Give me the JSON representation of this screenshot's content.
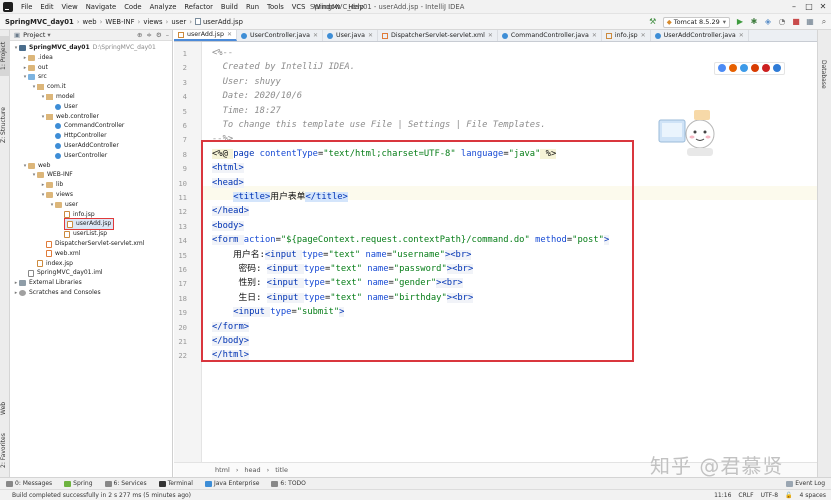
{
  "menubar": {
    "items": [
      "File",
      "Edit",
      "View",
      "Navigate",
      "Code",
      "Analyze",
      "Refactor",
      "Build",
      "Run",
      "Tools",
      "VCS",
      "Window",
      "Help"
    ],
    "window_title": "SpringMVC_day01 - userAdd.jsp - IntelliJ IDEA"
  },
  "navbar": {
    "crumbs": [
      "SpringMVC_day01",
      "web",
      "WEB-INF",
      "views",
      "user",
      "userAdd.jsp"
    ],
    "run_config": "Tomcat 8.5.29"
  },
  "project_panel": {
    "title": "Project",
    "tree": [
      {
        "label": "SpringMVC_day01",
        "extra": "D:\\SpringMVC_day01",
        "icon": "module",
        "indent": 0,
        "arrow": "▾",
        "bold": true
      },
      {
        "label": ".idea",
        "icon": "folder",
        "indent": 1,
        "arrow": "▸"
      },
      {
        "label": "out",
        "icon": "folder",
        "indent": 1,
        "arrow": "▸"
      },
      {
        "label": "src",
        "icon": "srcfolder",
        "indent": 1,
        "arrow": "▾"
      },
      {
        "label": "com.it",
        "icon": "pkg",
        "indent": 2,
        "arrow": "▾"
      },
      {
        "label": "model",
        "icon": "pkg",
        "indent": 3,
        "arrow": "▾"
      },
      {
        "label": "User",
        "icon": "class",
        "indent": 4,
        "arrow": ""
      },
      {
        "label": "web.controller",
        "icon": "pkg",
        "indent": 3,
        "arrow": "▾"
      },
      {
        "label": "CommandController",
        "icon": "class",
        "indent": 4,
        "arrow": ""
      },
      {
        "label": "HttpController",
        "icon": "class",
        "indent": 4,
        "arrow": ""
      },
      {
        "label": "UserAddController",
        "icon": "class",
        "indent": 4,
        "arrow": ""
      },
      {
        "label": "UserController",
        "icon": "class",
        "indent": 4,
        "arrow": ""
      },
      {
        "label": "web",
        "icon": "folder",
        "indent": 1,
        "arrow": "▾"
      },
      {
        "label": "WEB-INF",
        "icon": "folder",
        "indent": 2,
        "arrow": "▾"
      },
      {
        "label": "lib",
        "icon": "folder",
        "indent": 3,
        "arrow": "▸"
      },
      {
        "label": "views",
        "icon": "folder",
        "indent": 3,
        "arrow": "▾"
      },
      {
        "label": "user",
        "icon": "folder",
        "indent": 4,
        "arrow": "▾"
      },
      {
        "label": "info.jsp",
        "icon": "jsp",
        "indent": 5,
        "arrow": ""
      },
      {
        "label": "userAdd.jsp",
        "icon": "jsp",
        "indent": 5,
        "arrow": "",
        "selected": true
      },
      {
        "label": "userList.jsp",
        "icon": "jsp",
        "indent": 5,
        "arrow": ""
      },
      {
        "label": "DispatcherServlet-servlet.xml",
        "icon": "xml",
        "indent": 3,
        "arrow": ""
      },
      {
        "label": "web.xml",
        "icon": "xml",
        "indent": 3,
        "arrow": ""
      },
      {
        "label": "index.jsp",
        "icon": "jsp",
        "indent": 2,
        "arrow": ""
      },
      {
        "label": "SpringMVC_day01.iml",
        "icon": "iml",
        "indent": 1,
        "arrow": ""
      },
      {
        "label": "External Libraries",
        "icon": "lib",
        "indent": 0,
        "arrow": "▸"
      },
      {
        "label": "Scratches and Consoles",
        "icon": "scratch",
        "indent": 0,
        "arrow": "▸"
      }
    ]
  },
  "left_strip": [
    "1: Project",
    "Z: Structure",
    "Web",
    "2: Favorites"
  ],
  "right_strip": [
    "Database"
  ],
  "tabs": [
    {
      "label": "userAdd.jsp",
      "active": true
    },
    {
      "label": "UserController.java"
    },
    {
      "label": "User.java"
    },
    {
      "label": "DispatcherServlet-servlet.xml"
    },
    {
      "label": "CommandController.java"
    },
    {
      "label": "info.jsp"
    },
    {
      "label": "UserAddController.java"
    }
  ],
  "code_lines": [
    [
      [
        "cmt",
        "<%--"
      ]
    ],
    [
      [
        "cmt",
        "  Created by IntelliJ IDEA."
      ]
    ],
    [
      [
        "cmt",
        "  User: shuyy"
      ]
    ],
    [
      [
        "cmt",
        "  Date: 2020/10/6"
      ]
    ],
    [
      [
        "cmt",
        "  Time: 18:27"
      ]
    ],
    [
      [
        "cmt",
        "  To change this template use File | Settings | File Templates."
      ]
    ],
    [
      [
        "cmt",
        "--%>"
      ]
    ],
    [
      [
        "jsp",
        "<%@ "
      ],
      [
        "tgn",
        "page "
      ],
      [
        "an",
        "contentType"
      ],
      [
        "",
        "="
      ],
      [
        "av",
        "\"text/html;charset=UTF-8\""
      ],
      [
        "",
        ""
      ],
      [
        "an",
        " language"
      ],
      [
        "",
        "="
      ],
      [
        "av",
        "\"java\""
      ],
      [
        "jsp",
        " %>"
      ]
    ],
    [
      [
        "tg",
        "<html>"
      ]
    ],
    [
      [
        "tg",
        "<head>"
      ]
    ],
    [
      [
        "",
        "    "
      ],
      [
        "tg",
        "<title>"
      ],
      [
        "",
        "用户表单"
      ],
      [
        "tg",
        "</title>"
      ]
    ],
    [
      [
        "tg",
        "</head>"
      ]
    ],
    [
      [
        "tg",
        "<body>"
      ]
    ],
    [
      [
        "tg",
        "<form "
      ],
      [
        "an",
        "action"
      ],
      [
        "",
        "="
      ],
      [
        "av",
        "\"${pageContext.request.contextPath}/command.do\""
      ],
      [
        "an",
        " method"
      ],
      [
        "",
        "="
      ],
      [
        "av",
        "\"post\""
      ],
      [
        "tg",
        ">"
      ]
    ],
    [
      [
        "",
        "    用户名:"
      ],
      [
        "tg",
        "<input "
      ],
      [
        "an",
        "type"
      ],
      [
        "",
        "="
      ],
      [
        "av",
        "\"text\""
      ],
      [
        "an",
        " name"
      ],
      [
        "",
        "="
      ],
      [
        "av",
        "\"username\""
      ],
      [
        "tg",
        ">"
      ],
      [
        "tg",
        "<br>"
      ]
    ],
    [
      [
        "",
        "     密码: "
      ],
      [
        "tg",
        "<input "
      ],
      [
        "an",
        "type"
      ],
      [
        "",
        "="
      ],
      [
        "av",
        "\"text\""
      ],
      [
        "an",
        " name"
      ],
      [
        "",
        "="
      ],
      [
        "av",
        "\"password\""
      ],
      [
        "tg",
        ">"
      ],
      [
        "tg",
        "<br>"
      ]
    ],
    [
      [
        "",
        "     性别: "
      ],
      [
        "tg",
        "<input "
      ],
      [
        "an",
        "type"
      ],
      [
        "",
        "="
      ],
      [
        "av",
        "\"text\""
      ],
      [
        "an",
        " name"
      ],
      [
        "",
        "="
      ],
      [
        "av",
        "\"gender\""
      ],
      [
        "tg",
        ">"
      ],
      [
        "tg",
        "<br>"
      ]
    ],
    [
      [
        "",
        "     生日: "
      ],
      [
        "tg",
        "<input "
      ],
      [
        "an",
        "type"
      ],
      [
        "",
        "="
      ],
      [
        "av",
        "\"text\""
      ],
      [
        "an",
        " name"
      ],
      [
        "",
        "="
      ],
      [
        "av",
        "\"birthday\""
      ],
      [
        "tg",
        ">"
      ],
      [
        "tg",
        "<br>"
      ]
    ],
    [
      [
        "",
        "    "
      ],
      [
        "tg",
        "<input "
      ],
      [
        "an",
        "type"
      ],
      [
        "",
        "="
      ],
      [
        "av",
        "\"submit\""
      ],
      [
        "tg",
        ">"
      ]
    ],
    [
      [
        "tg",
        "</form>"
      ]
    ],
    [
      [
        "tg",
        "</body>"
      ]
    ],
    [
      [
        "tg",
        "</html>"
      ]
    ]
  ],
  "editor_breadcrumb": [
    "html",
    "head",
    "title"
  ],
  "watermark": "知乎 @君慕贤",
  "bottom_tools": [
    "0: Messages",
    "Spring",
    "6: Services",
    "Terminal",
    "Java Enterprise",
    "6: TODO"
  ],
  "bottom_right_tool": "Event Log",
  "status": {
    "message": "Build completed successfully in 2 s 277 ms (5 minutes ago)",
    "position": "11:16",
    "line_sep": "CRLF",
    "encoding": "UTF-8",
    "indent": "4 spaces"
  }
}
